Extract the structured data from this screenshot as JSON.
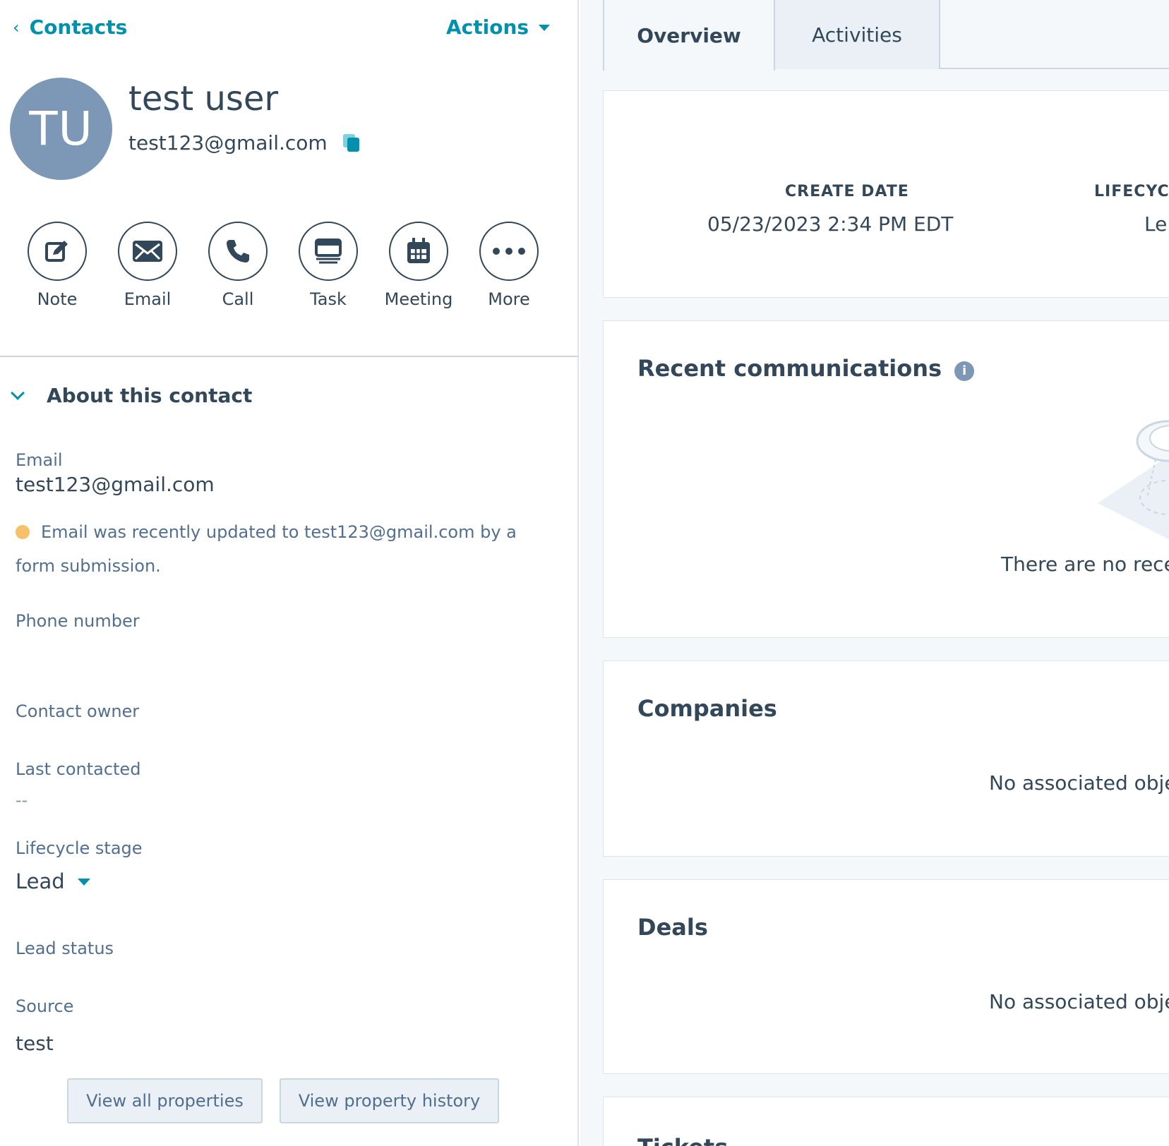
{
  "nav": {
    "back_label": "Contacts",
    "actions_label": "Actions"
  },
  "contact": {
    "initials": "TU",
    "name": "test user",
    "email": "test123@gmail.com"
  },
  "quick_actions": [
    {
      "label": "Note",
      "icon": "note-icon"
    },
    {
      "label": "Email",
      "icon": "email-icon"
    },
    {
      "label": "Call",
      "icon": "call-icon"
    },
    {
      "label": "Task",
      "icon": "task-icon"
    },
    {
      "label": "Meeting",
      "icon": "meeting-icon"
    },
    {
      "label": "More",
      "icon": "more-icon"
    }
  ],
  "about": {
    "title": "About this contact",
    "email_label": "Email",
    "email_value": "test123@gmail.com",
    "email_notice": "Email was recently updated to test123@gmail.com by a form submission.",
    "phone_label": "Phone number",
    "owner_label": "Contact owner",
    "last_contacted_label": "Last contacted",
    "last_contacted_value": "--",
    "lifecycle_label": "Lifecycle stage",
    "lifecycle_value": "Lead",
    "lead_status_label": "Lead status",
    "source_label": "Source",
    "source_value": "test",
    "view_all_label": "View all properties",
    "view_history_label": "View property history"
  },
  "tabs": [
    {
      "label": "Overview",
      "active": true
    },
    {
      "label": "Activities",
      "active": false
    }
  ],
  "overview": {
    "create_date_label": "CREATE DATE",
    "create_date_value": "05/23/2023 2:34 PM EDT",
    "lifecycle_label": "LIFECYC",
    "lifecycle_value": "Le",
    "recent_comm_title": "Recent communications",
    "recent_comm_empty": "There are no recen",
    "companies_title": "Companies",
    "companies_empty": "No associated obje",
    "deals_title": "Deals",
    "deals_empty": "No associated obje",
    "tickets_title": "Tickets"
  },
  "colors": {
    "accent": "#0091ae",
    "text": "#33475b",
    "muted": "#516f90",
    "avatar": "#7c98b6",
    "notice_dot": "#f5c26b"
  }
}
